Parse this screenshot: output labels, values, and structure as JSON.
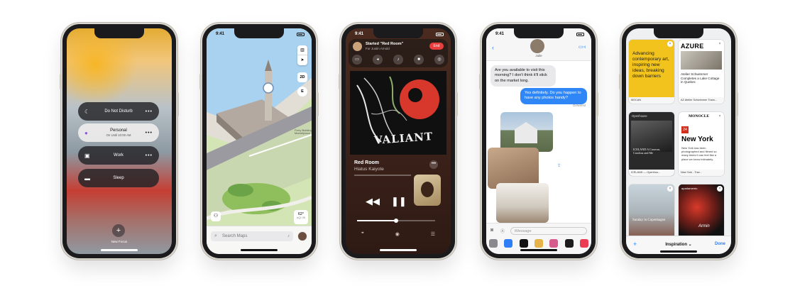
{
  "status_time": "9:41",
  "phone1": {
    "focus_modes": [
      {
        "label": "Do Not Disturb",
        "icon": "moon-icon"
      },
      {
        "label": "Personal",
        "sub": "On Until 10:00 AM",
        "icon": "person-icon"
      },
      {
        "label": "Work",
        "icon": "badge-icon"
      },
      {
        "label": "Sleep",
        "icon": "bed-icon"
      }
    ],
    "new_focus": "New Focus"
  },
  "phone2": {
    "search_placeholder": "Search Maps",
    "mode_2d": "2D",
    "compass": "E",
    "temp": "62°",
    "aqi": "AQI 39",
    "ferry_label": "Ferry Building Marketplace"
  },
  "phone3": {
    "share_title": "Started \"Red Room\"",
    "share_sub": "For Justin Arnold",
    "end_label": "End",
    "album_text": "VALIANT",
    "song": "Red Room",
    "artist": "Hiatus Kaiyote"
  },
  "phone4": {
    "contact": "Julie",
    "msg_in": "Are you available to visit this morning? I don't think it'll stick on the market long.",
    "msg_out": "Yes definitely. Do you happen to have any photos handy?",
    "delivered": "Delivered",
    "placeholder": "iMessage"
  },
  "phone5": {
    "tiles": [
      {
        "text": "Advancing contemporary art, inspiring new ideas, breaking down barriers",
        "source": "MOCAN"
      },
      {
        "title": "AZURE",
        "text": "Atelier Schwimmer Completes a Lake Cottage in Quebec",
        "source": "AZ  Atelier Schwimmer Trans..."
      },
      {
        "brand": "Openhouse",
        "text": "ICELAND A Caravan, Carolina and Me",
        "source": "ICELAND — Openhou..."
      },
      {
        "brand": "MONOCLE",
        "badge": "24",
        "title": "New York",
        "text": "New York has been photographed and filmed so many times it can feel like a place we know intimately.",
        "source": "New York - Trav..."
      },
      {
        "text": "Sunday in Copenhagen"
      },
      {
        "brand": "apartamento",
        "text": "Armin"
      }
    ],
    "group": "Inspiration",
    "done": "Done"
  }
}
